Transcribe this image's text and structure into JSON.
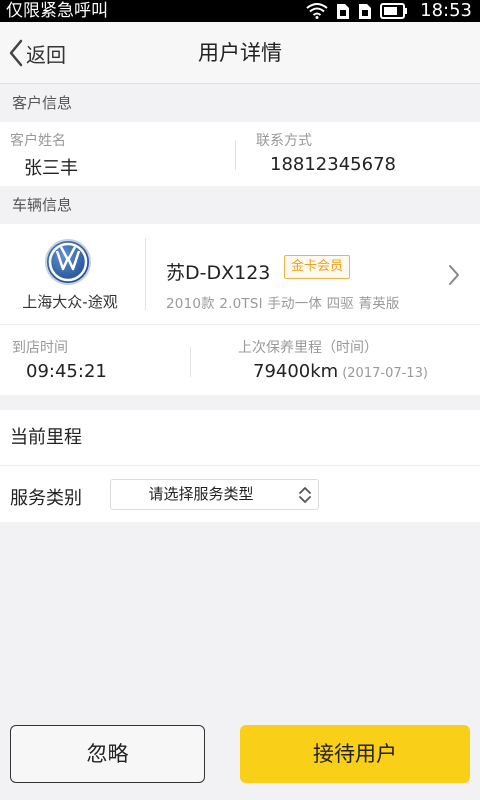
{
  "status_bar": {
    "carrier": "仅限紧急呼叫",
    "time": "18:53"
  },
  "nav": {
    "back_label": "返回",
    "title": "用户详情"
  },
  "customer_section": {
    "header": "客户信息",
    "name_label": "客户姓名",
    "name_value": "张三丰",
    "contact_label": "联系方式",
    "contact_value": "18812345678"
  },
  "vehicle_section": {
    "header": "车辆信息",
    "brand": "上海大众-途观",
    "plate": "苏D-DX123",
    "member_badge": "金卡会员",
    "model": "2010款 2.0TSI 手动一体 四驱 菁英版",
    "arrival_label": "到店时间",
    "arrival_value": "09:45:21",
    "last_service_label": "上次保养里程（时间）",
    "last_service_mileage": "79400km",
    "last_service_date": "(2017-07-13)"
  },
  "form": {
    "current_mileage_label": "当前里程",
    "service_type_label": "服务类别",
    "service_type_placeholder": "请选择服务类型"
  },
  "actions": {
    "ignore_label": "忽略",
    "receive_label": "接待用户"
  },
  "colors": {
    "accent": "#f9cf17",
    "badge": "#f0a020"
  },
  "icons": [
    "wifi-icon",
    "sim-icon",
    "battery-icon",
    "back-chevron-icon",
    "vw-logo-icon",
    "chevron-right-icon",
    "updown-arrows-icon"
  ]
}
